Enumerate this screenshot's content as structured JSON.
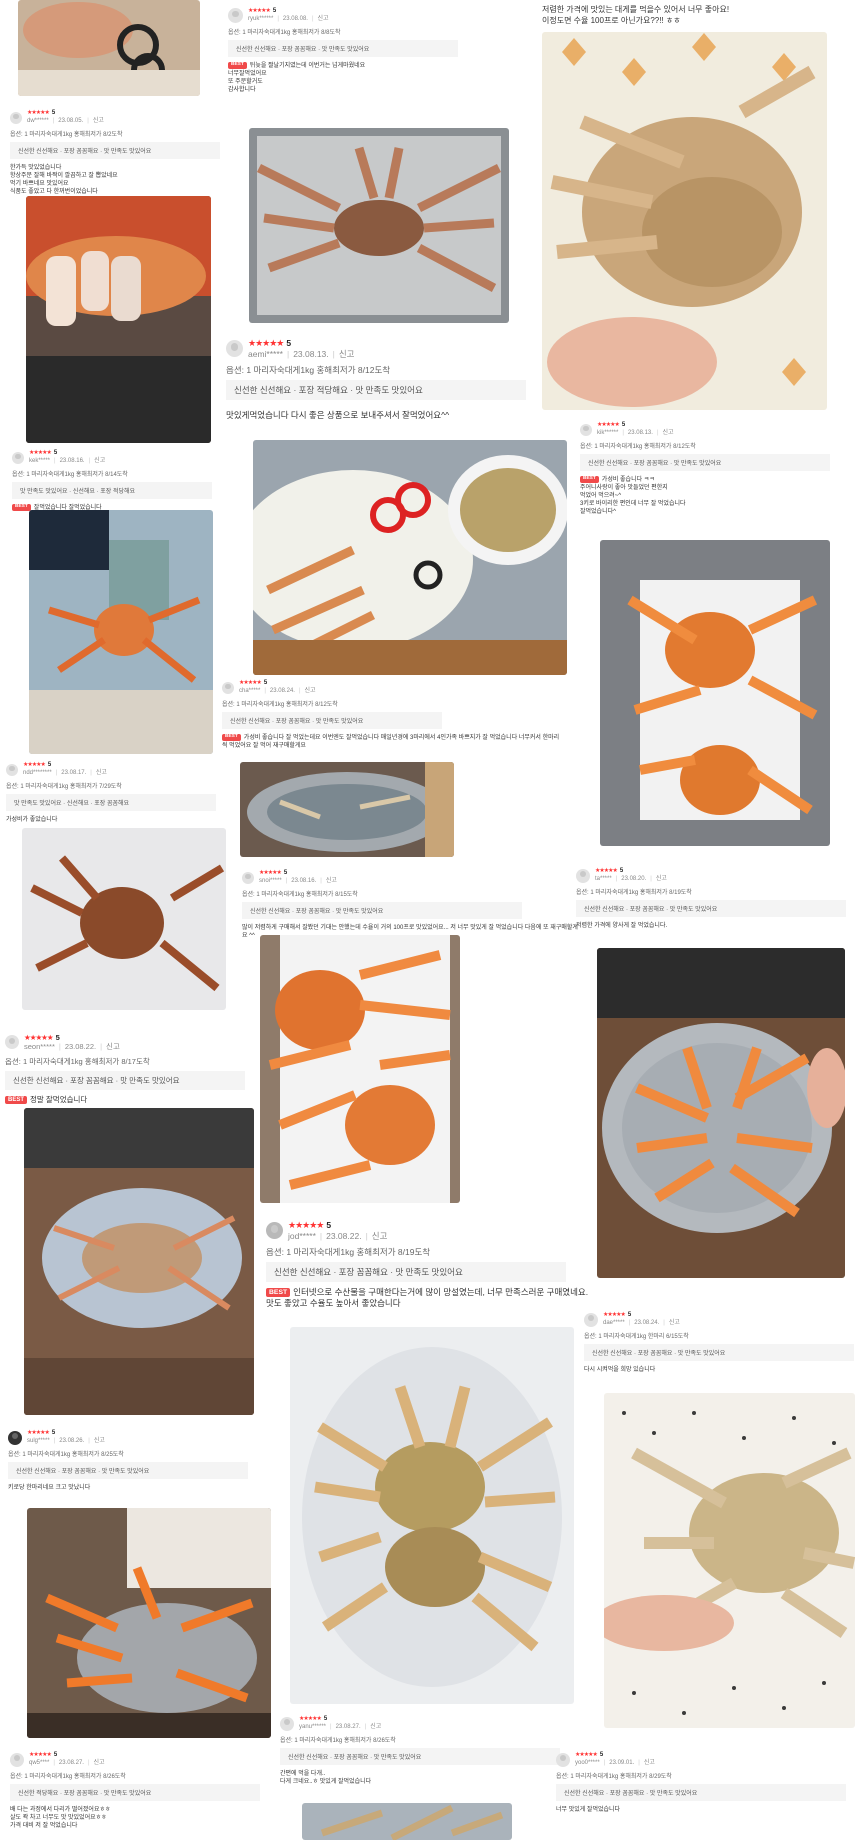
{
  "report_label": "신고",
  "best_badge": "BEST",
  "reviews": [
    {
      "user": "ryuk******",
      "date": "23.08.08.",
      "score": "5",
      "option": "옵션: 1 마리자숙대게1kg 홍해최저가 8/8도착",
      "tags": "신선한 신선해요 · 포장 꼼꼼해요 · 맛 만족도 맛있어요",
      "text": "BEST 뒤늦을 짤날기지였는데 이번거는 넘게마웠네요\n너무잘먹었어요\n또 주문할거도\n감사합니다"
    },
    {
      "user": "dw******",
      "date": "23.08.05.",
      "score": "5",
      "option": "옵션: 1 마리자숙대게1kg 홍해최저가 8/2도착",
      "tags": "신선한 신선해요 · 포장 꼼꼼해요 · 맛 만족도 맛있어요",
      "text": "한가득 맛있었습니다\n항상주문 잘해 바짝이 깔끔하고 잘 뽑았네요\n먹기 바쁘네요 맛있어요\n식품도 좋았고 다 한꺼번이었습니다"
    },
    {
      "user": "aemi*****",
      "date": "23.08.13.",
      "score": "5",
      "option": "옵션: 1 마리자숙대게1kg 홍해최저가 8/12도착",
      "tags": "신선한 신선해요 · 포장 적당해요 · 맛 만족도 맛있어요",
      "text": "맛있게먹었습니다 다시 좋은 상품으로 보내주셔서 잘먹었어요^^"
    },
    {
      "user": "kek*****",
      "date": "23.08.16.",
      "score": "5",
      "option": "옵션: 1 마리자숙대게1kg 홍해최저가 8/14도착",
      "tags": "맛 만족도 맛있어요 · 신선해요 · 포장 적당해요",
      "text": "BEST 잘먹었습니다 잘먹었습니다"
    },
    {
      "user": "kik******",
      "date": "23.08.13.",
      "score": "5",
      "option": "옵션: 1 마리자숙대게1kg 홍해최저가 8/12도착",
      "tags": "신선한 신선해요 · 포장 꼼꼼해요 · 맛 만족도 맛있어요",
      "text": "BEST 가성비 좋습니다 ㅋㅋ\n주어니사랑이 좋아 맛들었던 편한지\n먹었어 먹으려~^\n3키로 바이리한 편인데 너무 잘 먹었습니다\n잘먹었습니다^"
    },
    {
      "user": "cha*****",
      "date": "23.08.24.",
      "score": "5",
      "option": "옵션: 1 마리자숙대게1kg 홍해최저가 8/12도착",
      "tags": "신선한 신선해요 · 포장 꼼꼼해요 · 맛 만족도 맛있어요",
      "text": "BEST 가성비 좋습니다 잘 먹었는데요 이번엔도 잘먹었습니다 매일년경에 3마리에서 4인가족 바쁘지가 잘 먹었습니다 너무커서 한마리씩 먹었어요 잘 먹어 재구매할게요"
    },
    {
      "user": "ndd********",
      "date": "23.08.17.",
      "score": "5",
      "option": "옵션: 1 마리자숙대게1kg 홍해최저가 7/29도착",
      "tags": "맛 만족도 맛있어요 · 신선해요 · 포장 꼼꼼해요",
      "text": "가성비가 좋았습니다"
    },
    {
      "user": "snoi*****",
      "date": "23.08.16.",
      "score": "5",
      "option": "옵션: 1 마리자숙대게1kg 홍해최저가 8/15도착",
      "tags": "신선한 신선해요 · 포장 꼼꼼해요 · 맛 만족도 맛있어요",
      "text": "많이 저렴하게 구매해서 잘봤던 기대는 안했는데 수율이 거의 100프로 맛있었어요... 저 너무 맛있게 잘 먹었습니다 다음에 또 재구매할게요 ^^"
    },
    {
      "user": "ta*****",
      "date": "23.08.20.",
      "score": "5",
      "option": "옵션: 1 마리자숙대게1kg 홍해최저가 8/19도착",
      "tags": "신선한 신선해요 · 포장 꼼꼼해요 · 맛 만족도 맛있어요",
      "text": "저렴한 가격에 양사게 잘 먹었습니다."
    },
    {
      "user": "seon*****",
      "date": "23.08.22.",
      "score": "5",
      "option": "옵션: 1 마리자숙대게1kg 홍해최저가 8/17도착",
      "tags": "신선한 신선해요 · 포장 꼼꼼해요 · 맛 만족도 맛있어요",
      "text": "BEST 정말 잘먹었습니다"
    },
    {
      "user": "jod*****",
      "date": "23.08.22.",
      "score": "5",
      "option": "옵션: 1 마리자숙대게1kg 홍해최저가 8/19도착",
      "tags": "신선한 신선해요 · 포장 꼼꼼해요 · 맛 만족도 맛있어요",
      "text": "BEST 인터넷으로 수산물을 구매한다는거에 많이 망설였는데, 너무 만족스러운 구매였네요.\n맛도 좋았고 수율도 높아서 좋았습니다"
    },
    {
      "user": "dae*****",
      "date": "23.08.24.",
      "score": "5",
      "option": "옵션: 1 마리자숙대게1kg 한마리 6/15도착",
      "tags": "신선한 신선해요 · 포장 꼼꼼해요 · 맛 만족도 맛있어요",
      "text": "다시 시켜먹을 희망 있습니다"
    },
    {
      "user": "sulg*****",
      "date": "23.08.26.",
      "score": "5",
      "option": "옵션: 1 마리자숙대게1kg 홍해최저가 8/25도착",
      "tags": "신선한 신선해요 · 포장 꼼꼼해요 · 맛 만족도 맛있어요",
      "text": "키로당 한마리네요 크고 맛났니다"
    },
    {
      "user": "yanu******",
      "date": "23.08.27.",
      "score": "5",
      "option": "옵션: 1 마리자숙대게1kg 홍해최저가 8/26도착",
      "tags": "신선한 신선해요 · 포장 꼼꼼해요 · 맛 만족도 맛있어요",
      "text": "간편에 먹을 다개..\n다게 크네요..ㅎ 맛있게 잘먹었습니다"
    },
    {
      "user": "qw5****",
      "date": "23.08.27.",
      "score": "5",
      "option": "옵션: 1 마리자숙대게1kg 홍해최저가 8/26도착",
      "tags": "신선한 적당해요 · 포장 꼼꼼해요 · 맛 만족도 맛있어요",
      "text": "배 다는 과정에서 다리가 떨어졌어요ㅎㅎ\n살도 꽉 차고 너무도 맛 맛있었어요ㅎㅎ\n가격 대비 저 잘 먹었습니다"
    },
    {
      "user": "yoo0*****",
      "date": "23.09.01.",
      "score": "5",
      "option": "옵션: 1 마리자숙대게1kg 홍해최저가 8/29도착",
      "tags": "신선한 신선해요 · 포장 꼼꼼해요 · 맛 만족도 맛있어요",
      "text": "너무 맛있게 잘먹었습니다"
    }
  ],
  "top_snippet": "저렴한 가격에 맛있는 대게를 먹을수 있어서 너무 좋아요!\n이정도면 수율 100프로 아닌가요??!! ㅎㅎ",
  "colors": {
    "star": "#ff3333",
    "best": "#f04a4a",
    "tag_bg": "#f4f4f4"
  }
}
